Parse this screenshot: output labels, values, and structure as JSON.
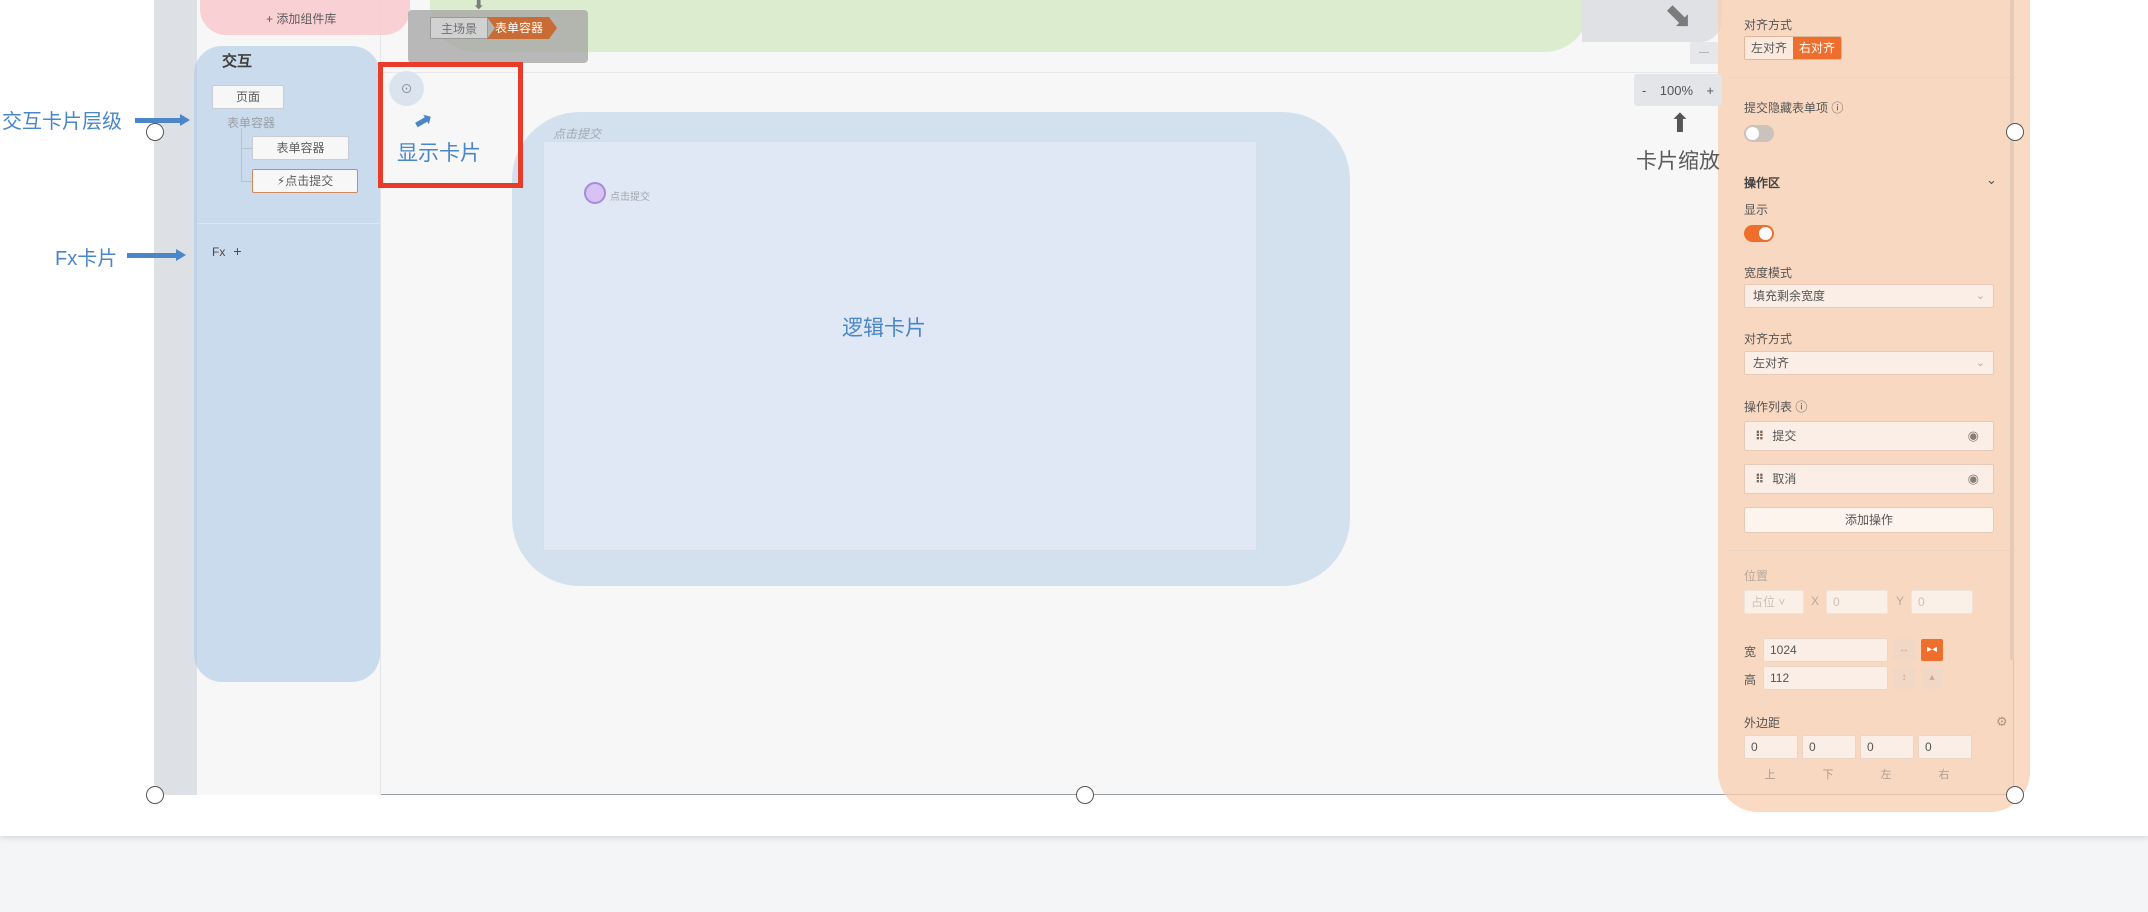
{
  "canvas": {
    "add_library": "+ 添加组件库",
    "breadcrumb": {
      "main_scene": "主场景",
      "form_container": "表单容器"
    }
  },
  "interaction_panel": {
    "title": "交互",
    "page_node": "页面",
    "form_container_label": "表单容器",
    "form_container_node": "表单容器",
    "click_submit_node": "⚡点击提交",
    "fx_label": "Fx",
    "fx_add": "+"
  },
  "annotations": {
    "interaction_level": "交互卡片层级",
    "fx_card": "Fx卡片",
    "display_card": "显示卡片",
    "logic_card": "逻辑卡片",
    "card_zoom": "卡片缩放"
  },
  "logic": {
    "tag": "点击提交",
    "node_label": "点击提交"
  },
  "zoom": {
    "minus": "-",
    "value": "100%",
    "plus": "+"
  },
  "props": {
    "align_label": "对齐方式",
    "align_left": "左对齐",
    "align_right": "右对齐",
    "submit_hidden_label": "提交隐藏表单项 ⓘ",
    "ops_area_label": "操作区",
    "show_label": "显示",
    "width_mode_label": "宽度模式",
    "width_mode_value": "填充剩余宽度",
    "align2_label": "对齐方式",
    "align2_value": "左对齐",
    "ops_list_label": "操作列表 ⓘ",
    "op_submit": "提交",
    "op_cancel": "取消",
    "add_op": "添加操作",
    "position_label": "位置",
    "position_value": "占位",
    "x_label": "X",
    "x_value": "0",
    "y_label": "Y",
    "y_value": "0",
    "width_label": "宽",
    "width_value": "1024",
    "height_label": "高",
    "height_value": "112",
    "margin_label": "外边距",
    "margin_top": "0",
    "margin_bottom": "0",
    "margin_left": "0",
    "margin_right": "0",
    "margin_top_lbl": "上",
    "margin_bottom_lbl": "下",
    "margin_left_lbl": "左",
    "margin_right_lbl": "右"
  },
  "colors": {
    "accent": "#ee6e2d",
    "annotation_blue": "#4a86c8",
    "highlight_red": "#e83b2a"
  }
}
